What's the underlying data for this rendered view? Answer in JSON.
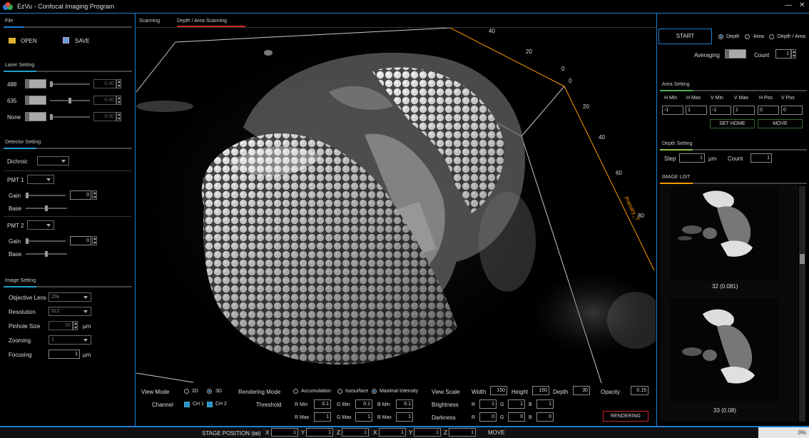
{
  "app": {
    "title": "EzVu - Confocal Imaging Program",
    "minimize": "—",
    "close": "✕",
    "colors": {
      "accent": "#1e7fd0",
      "green": "#4caf50",
      "red": "#c62828",
      "orange": "#ff9800"
    }
  },
  "file": {
    "title": "File",
    "open": "OPEN",
    "save": "SAVE",
    "open_icon": "folder-icon",
    "save_icon": "floppy-icon"
  },
  "laser": {
    "title": "Laser Setting",
    "rows": [
      {
        "label": "488",
        "value": "0.00"
      },
      {
        "label": "635",
        "value": "0.00"
      },
      {
        "label": "None",
        "value": "0.00"
      }
    ]
  },
  "detector": {
    "title": "Detector Setting",
    "dichroic": "Dichroic",
    "pmt1": "PMT 1",
    "pmt2": "PMT 2",
    "gain": "Gain",
    "base": "Base",
    "gain1": "0",
    "gain2": "0"
  },
  "image_setting": {
    "title": "Image Setting",
    "objective_label": "Objective Lens",
    "objective": "20x",
    "resolution_label": "Resolution",
    "resolution": "512",
    "pinhole_label": "Pinhole Size",
    "pinhole": "60",
    "pinhole_unit": "μm",
    "zoom_label": "Zooming",
    "zoom": "1",
    "focus_label": "Focusing",
    "focus": "1",
    "focus_unit": "μm"
  },
  "tabs": {
    "scanning": "Scanning",
    "depth_area": "Depth / Area Scanning"
  },
  "viewer": {
    "axis_top": [
      "40",
      "20",
      "0"
    ],
    "axis_right": [
      "0",
      "20",
      "40",
      "60",
      "80"
    ],
    "axis_label": "Primary_Y"
  },
  "bottom_controls": {
    "view_mode": "View Mode",
    "mode_2d": "2D",
    "mode_3d": "3D",
    "channel": "Channel",
    "ch1": "CH 1",
    "ch2": "CH 2",
    "rendering_mode": "Rendering Mode",
    "accumulation": "Accumulation",
    "isosurface": "Isosurface",
    "maximal": "Maximal Intensity",
    "threshold": "Threshold",
    "r_min": "R Min",
    "g_min": "G Min",
    "b_min": "B Min",
    "r_max": "R Max",
    "g_max": "G Max",
    "b_max": "B Max",
    "r_min_v": "0.1",
    "g_min_v": "0.1",
    "b_min_v": "0.1",
    "r_max_v": "1",
    "g_max_v": "1",
    "b_max_v": "1",
    "view_scale": "View Scale",
    "width": "Width",
    "height": "Height",
    "depth": "Depth",
    "width_v": "150",
    "height_v": "150",
    "depth_v": "30",
    "opacity": "Opacity",
    "opacity_v": "0.15",
    "brightness": "Brightness",
    "darkness": "Darkness",
    "r": "R",
    "g": "G",
    "b": "B",
    "br_r": "1",
    "br_g": "1",
    "br_b": "1",
    "dk_r": "0",
    "dk_g": "0",
    "dk_b": "0",
    "rendering": "RENDERING"
  },
  "right": {
    "start": "START",
    "depth": "Depth",
    "area": "Area",
    "depth_area": "Depth / Area",
    "averaging": "Averaging",
    "count": "Count",
    "count_v": "1",
    "area_title": "Area Setting",
    "area_headers": [
      "H Min",
      "H Max",
      "V Min",
      "V Max",
      "H Pos",
      "V Pos"
    ],
    "area_values": [
      "-1",
      "1",
      "-1",
      "1",
      "0",
      "0"
    ],
    "set_home": "SET HOME",
    "move": "MOVE",
    "depth_title": "Depth Setting",
    "step": "Step",
    "step_v": "1",
    "step_unit": "μm",
    "dcount": "Count",
    "dcount_v": "1",
    "image_list": "IMAGE LIST",
    "images": [
      {
        "caption": "32 (0.081)"
      },
      {
        "caption": "33 (0.08)"
      }
    ]
  },
  "stage": {
    "label": "STAGE POSITION (㎜)",
    "fields": [
      {
        "label": "X",
        "value": "1"
      },
      {
        "label": "Y",
        "value": "1"
      },
      {
        "label": "Z",
        "value": "1"
      },
      {
        "label": "X",
        "value": "1"
      },
      {
        "label": "Y",
        "value": "1"
      },
      {
        "label": "Z",
        "value": "1"
      }
    ],
    "move": "MOVE",
    "progress": 0,
    "progress_text": "0%"
  }
}
